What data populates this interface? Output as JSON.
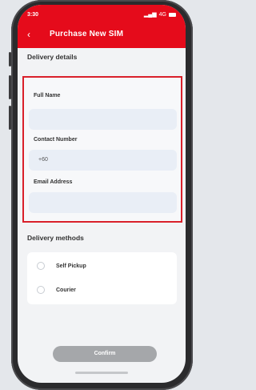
{
  "status": {
    "time": "3:30",
    "network": "4G"
  },
  "header": {
    "title": "Purchase New SIM",
    "back_icon": "chevron-left-icon"
  },
  "delivery_details": {
    "title": "Delivery details",
    "fields": [
      {
        "label": "Full Name",
        "value": "",
        "placeholder": ""
      },
      {
        "label": "Contact Number",
        "value": "+60",
        "placeholder": ""
      },
      {
        "label": "Email Address",
        "value": "",
        "placeholder": ""
      }
    ]
  },
  "delivery_methods": {
    "title": "Delivery methods",
    "options": [
      {
        "label": "Self Pickup",
        "selected": false
      },
      {
        "label": "Courier",
        "selected": false
      }
    ]
  },
  "confirm": {
    "label": "Confirm",
    "enabled": false
  },
  "colors": {
    "brand_red": "#e50b1b",
    "highlight_border": "#d9202a",
    "disabled_button": "#a5a7aa"
  }
}
